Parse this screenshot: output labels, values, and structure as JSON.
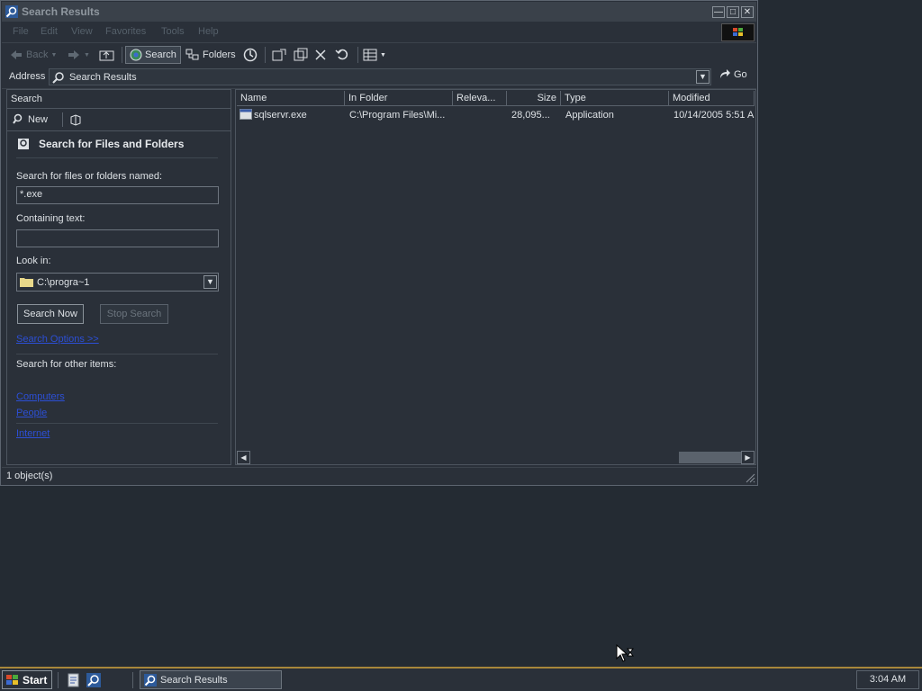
{
  "window": {
    "title": "Search Results",
    "controls": [
      "minimize",
      "maximize",
      "close"
    ]
  },
  "menu": [
    "File",
    "Edit",
    "View",
    "Favorites",
    "Tools",
    "Help"
  ],
  "toolbar": {
    "back": "Back",
    "search": "Search",
    "folders": "Folders"
  },
  "address": {
    "label": "Address",
    "value": "Search Results",
    "go": "Go"
  },
  "search_pane": {
    "header": "Search",
    "new_label": "New",
    "title": "Search for Files and Folders",
    "name_label": "Search for files or folders named:",
    "name_value": "*.exe",
    "containing_label": "Containing text:",
    "containing_value": "",
    "look_in_label": "Look in:",
    "look_in_value": "C:\\progra~1",
    "search_now": "Search Now",
    "stop_search": "Stop Search",
    "options_link": "Search Options >>",
    "other_items_label": "Search for other items:",
    "other_links": [
      "Computers",
      "People",
      "Internet"
    ]
  },
  "results": {
    "columns": [
      "Name",
      "In Folder",
      "Releva...",
      "Size",
      "Type",
      "Modified"
    ],
    "rows": [
      {
        "name": "sqlservr.exe",
        "folder": "C:\\Program Files\\Mi...",
        "relevance": "",
        "size": "28,095...",
        "type": "Application",
        "modified": "10/14/2005 5:51 A"
      }
    ]
  },
  "status": {
    "text": "1 object(s)"
  },
  "taskbar": {
    "start": "Start",
    "task": "Search Results",
    "clock": "3:04 AM"
  },
  "colors": {
    "desktop": "#242b33",
    "window": "#2a3039",
    "link": "#2c4fd6",
    "taskbar_border": "#a8873a"
  }
}
